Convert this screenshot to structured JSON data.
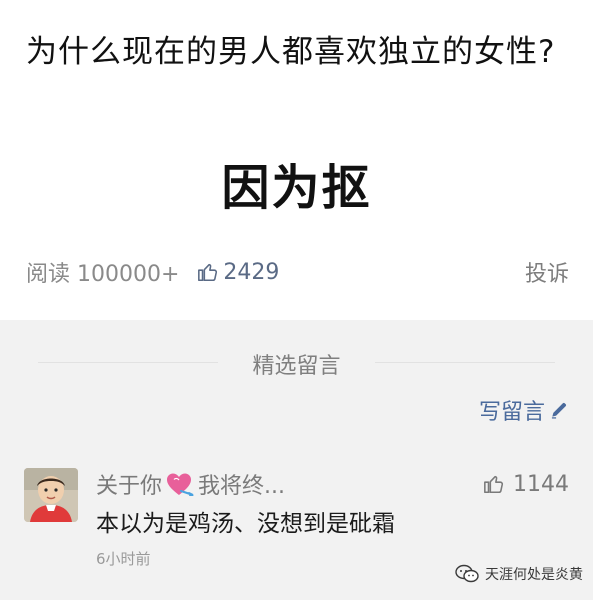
{
  "article": {
    "title": "为什么现在的男人都喜欢独立的女性?",
    "punchline": "因为抠",
    "reads_label": "阅读 100000+",
    "likes": "2429",
    "report": "投诉"
  },
  "comments_section": {
    "title": "精选留言",
    "write_label": "写留言",
    "items": [
      {
        "name_prefix": "关于你",
        "name_suffix": "我将终...",
        "likes": "1144",
        "text": "本以为是鸡汤、没想到是砒霜",
        "time": "6小时前"
      }
    ]
  },
  "watermark": {
    "text": "天涯何处是炎黄"
  },
  "colors": {
    "link_blue": "#4a6a9c",
    "comment_bg": "#f2f2f2",
    "heart_pink": "#e8609a"
  },
  "icons": [
    "thumbs-up-icon",
    "pencil-icon",
    "heart-icon",
    "wechat-icon"
  ]
}
